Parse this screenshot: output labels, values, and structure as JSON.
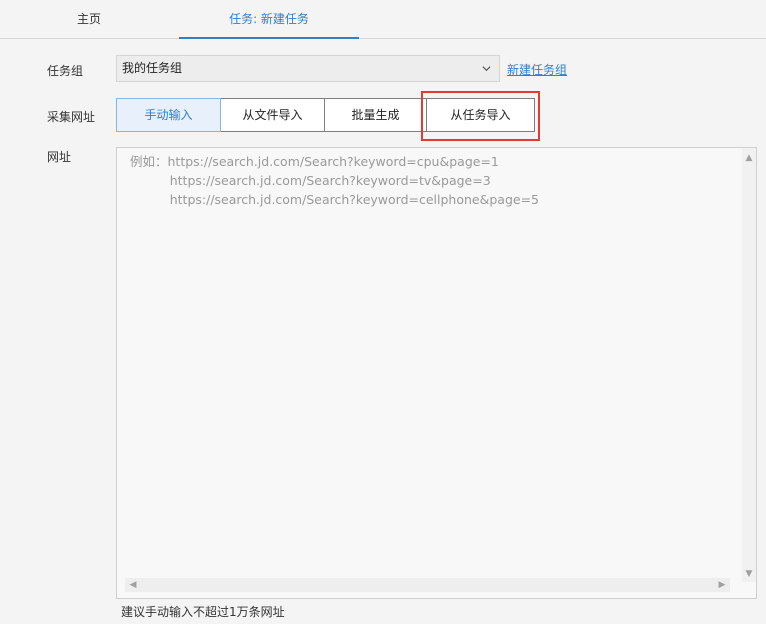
{
  "tabs": {
    "home": "主页",
    "new_task": "任务: 新建任务"
  },
  "task_group": {
    "label": "任务组",
    "selected": "我的任务组",
    "new_link": "新建任务组"
  },
  "source": {
    "label": "采集网址",
    "options": [
      "手动输入",
      "从文件导入",
      "批量生成",
      "从任务导入"
    ],
    "selected_index": 0
  },
  "urls": {
    "label": "网址",
    "placeholder": "例如：https://search.jd.com/Search?keyword=cpu&page=1\n          https://search.jd.com/Search?keyword=tv&page=3\n          https://search.jd.com/Search?keyword=cellphone&page=5"
  },
  "hint": "建议手动输入不超过1万条网址",
  "colors": {
    "accent": "#2f7fcf",
    "highlight": "#e33a36"
  }
}
